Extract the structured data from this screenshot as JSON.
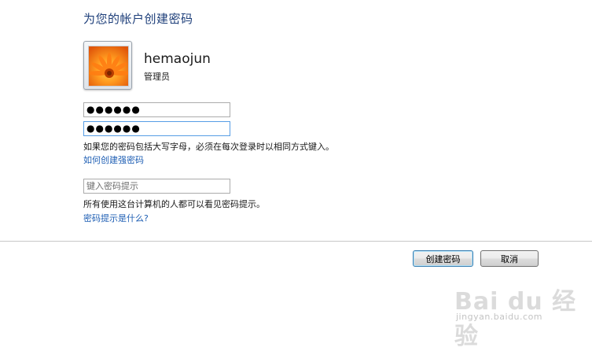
{
  "header": {
    "title": "为您的帐户创建密码"
  },
  "account": {
    "username": "hemaojun",
    "role": "管理员",
    "avatar_icon": "flower-picture-icon"
  },
  "form": {
    "password_value": "●●●●●●",
    "confirm_value": "●●●●●●",
    "case_note": "如果您的密码包括大写字母，必须在每次登录时以相同方式键入。",
    "strong_link": "如何创建强密码",
    "hint_placeholder": "键入密码提示",
    "hint_note": "所有使用这台计算机的人都可以看见密码提示。",
    "hint_link": "密码提示是什么?"
  },
  "buttons": {
    "create": "创建密码",
    "cancel": "取消"
  },
  "watermark": {
    "brand": "Bai du 经验",
    "url": "jingyan.baidu.com"
  },
  "colors": {
    "title": "#1e3f7a",
    "link": "#1f5fb4",
    "focus_border": "#569de5"
  }
}
